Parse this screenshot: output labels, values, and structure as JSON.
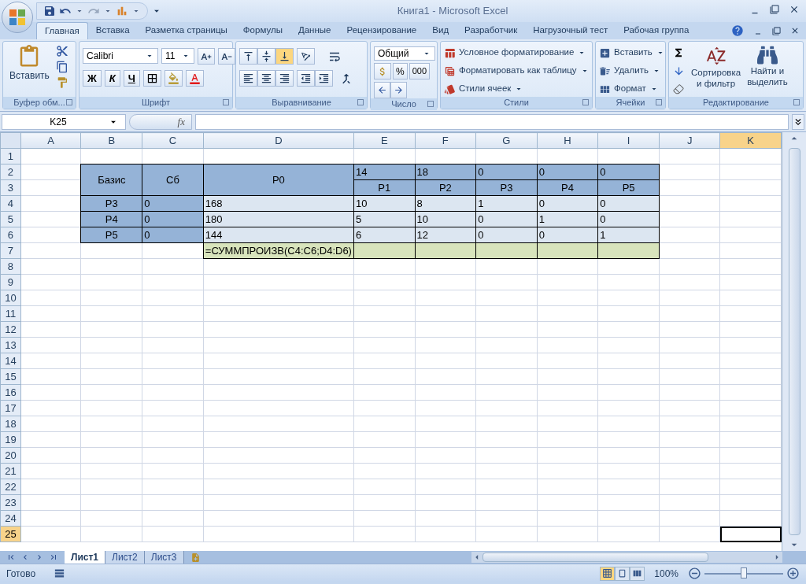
{
  "title_bar": {
    "title": "Книга1 - Microsoft Excel"
  },
  "ribbon_tabs": [
    {
      "label": "Главная",
      "selected": true
    },
    {
      "label": "Вставка",
      "selected": false
    },
    {
      "label": "Разметка страницы",
      "selected": false
    },
    {
      "label": "Формулы",
      "selected": false
    },
    {
      "label": "Данные",
      "selected": false
    },
    {
      "label": "Рецензирование",
      "selected": false
    },
    {
      "label": "Вид",
      "selected": false
    },
    {
      "label": "Разработчик",
      "selected": false
    },
    {
      "label": "Нагрузочный тест",
      "selected": false
    },
    {
      "label": "Рабочая группа",
      "selected": false
    }
  ],
  "ribbon": {
    "clipboard": {
      "paste": "Вставить",
      "label": "Буфер обм..."
    },
    "font": {
      "name": "Calibri",
      "size": "11",
      "bold": "Ж",
      "italic": "К",
      "underline": "Ч",
      "label": "Шрифт"
    },
    "alignment": {
      "vertical": [
        {
          "kind": "top",
          "selected": false
        },
        {
          "kind": "middle",
          "selected": false
        },
        {
          "kind": "bottom",
          "selected": true
        }
      ],
      "label": "Выравнивание"
    },
    "number": {
      "format": "Общий",
      "percent": "%",
      "thousands": "000",
      "label": "Число"
    },
    "styles": {
      "buttons": [
        "Условное форматирование",
        "Форматировать как таблицу",
        "Стили ячеек"
      ],
      "label": "Стили"
    },
    "cells": {
      "buttons": [
        "Вставить",
        "Удалить",
        "Формат"
      ],
      "label": "Ячейки"
    },
    "editing": {
      "sort": [
        "Сортировка",
        "и фильтр"
      ],
      "find": [
        "Найти и",
        "выделить"
      ],
      "label": "Редактирование"
    }
  },
  "formula_bar": {
    "name_box": "K25",
    "fx": "fx"
  },
  "sheet": {
    "columns": [
      {
        "label": "A",
        "selected": false
      },
      {
        "label": "B",
        "selected": false
      },
      {
        "label": "C",
        "selected": false
      },
      {
        "label": "D",
        "selected": false
      },
      {
        "label": "E",
        "selected": false
      },
      {
        "label": "F",
        "selected": false
      },
      {
        "label": "G",
        "selected": false
      },
      {
        "label": "H",
        "selected": false
      },
      {
        "label": "I",
        "selected": false
      },
      {
        "label": "J",
        "selected": false
      },
      {
        "label": "K",
        "selected": true
      }
    ],
    "rows": [
      {
        "number": "1",
        "selected": false
      },
      {
        "number": "2",
        "selected": false,
        "cells": [
          {
            "kind": "empty"
          },
          {
            "kind": "tall",
            "text": "Базис"
          },
          {
            "kind": "tall",
            "text": "Сб"
          },
          {
            "kind": "tall",
            "text": "P0"
          },
          {
            "kind": "head_left",
            "text": "14"
          },
          {
            "kind": "head_left",
            "text": "18"
          },
          {
            "kind": "head_left",
            "text": "0"
          },
          {
            "kind": "head_left",
            "text": "0"
          },
          {
            "kind": "head_left",
            "text": "0"
          },
          {
            "kind": "empty"
          },
          {
            "kind": "empty"
          }
        ]
      },
      {
        "number": "3",
        "selected": false,
        "cells": [
          {
            "kind": "empty"
          },
          {
            "kind": "head",
            "text": "P1"
          },
          {
            "kind": "head",
            "text": "P2"
          },
          {
            "kind": "head",
            "text": "P3"
          },
          {
            "kind": "head",
            "text": "P4"
          },
          {
            "kind": "head",
            "text": "P5"
          },
          {
            "kind": "empty"
          },
          {
            "kind": "empty"
          }
        ]
      },
      {
        "number": "4",
        "selected": false,
        "cells": [
          {
            "kind": "empty"
          },
          {
            "kind": "head",
            "text": "P3"
          },
          {
            "kind": "head_left",
            "text": "0"
          },
          {
            "kind": "value",
            "text": "168"
          },
          {
            "kind": "value",
            "text": "10"
          },
          {
            "kind": "value",
            "text": "8"
          },
          {
            "kind": "value",
            "text": "1"
          },
          {
            "kind": "value",
            "text": "0"
          },
          {
            "kind": "value",
            "text": "0"
          },
          {
            "kind": "empty"
          },
          {
            "kind": "empty"
          }
        ]
      },
      {
        "number": "5",
        "selected": false,
        "cells": [
          {
            "kind": "empty"
          },
          {
            "kind": "head",
            "text": "P4"
          },
          {
            "kind": "head_left",
            "text": "0"
          },
          {
            "kind": "value",
            "text": "180"
          },
          {
            "kind": "value",
            "text": "5"
          },
          {
            "kind": "value",
            "text": "10"
          },
          {
            "kind": "value",
            "text": "0"
          },
          {
            "kind": "value",
            "text": "1"
          },
          {
            "kind": "value",
            "text": "0"
          },
          {
            "kind": "empty"
          },
          {
            "kind": "empty"
          }
        ]
      },
      {
        "number": "6",
        "selected": false,
        "cells": [
          {
            "kind": "empty"
          },
          {
            "kind": "head",
            "text": "P5"
          },
          {
            "kind": "head_left",
            "text": "0"
          },
          {
            "kind": "value",
            "text": "144"
          },
          {
            "kind": "value",
            "text": "6"
          },
          {
            "kind": "value",
            "text": "12"
          },
          {
            "kind": "value",
            "text": "0"
          },
          {
            "kind": "value",
            "text": "0"
          },
          {
            "kind": "value",
            "text": "1"
          },
          {
            "kind": "empty"
          },
          {
            "kind": "empty"
          }
        ]
      },
      {
        "number": "7",
        "selected": false,
        "cells": [
          {
            "kind": "empty"
          },
          {
            "kind": "empty"
          },
          {
            "kind": "empty"
          },
          {
            "kind": "total",
            "text": "=СУММПРОИЗВ(C4:C6;D4:D6)"
          },
          {
            "kind": "total"
          },
          {
            "kind": "total"
          },
          {
            "kind": "total"
          },
          {
            "kind": "total"
          },
          {
            "kind": "total"
          },
          {
            "kind": "empty"
          },
          {
            "kind": "empty"
          }
        ]
      },
      {
        "number": "8",
        "selected": false
      },
      {
        "number": "9",
        "selected": false
      },
      {
        "number": "10",
        "selected": false
      },
      {
        "number": "11",
        "selected": false
      },
      {
        "number": "12",
        "selected": false
      },
      {
        "number": "13",
        "selected": false
      },
      {
        "number": "14",
        "selected": false
      },
      {
        "number": "15",
        "selected": false
      },
      {
        "number": "16",
        "selected": false
      },
      {
        "number": "17",
        "selected": false
      },
      {
        "number": "18",
        "selected": false
      },
      {
        "number": "19",
        "selected": false
      },
      {
        "number": "20",
        "selected": false
      },
      {
        "number": "21",
        "selected": false
      },
      {
        "number": "22",
        "selected": false
      },
      {
        "number": "23",
        "selected": false
      },
      {
        "number": "24",
        "selected": false
      },
      {
        "number": "25",
        "selected": true
      }
    ]
  },
  "sheet_tabs": [
    {
      "label": "Лист1",
      "selected": true
    },
    {
      "label": "Лист2",
      "selected": false
    },
    {
      "label": "Лист3",
      "selected": false
    }
  ],
  "status_bar": {
    "status": "Готово",
    "views": [
      {
        "kind": "normal",
        "selected": true
      },
      {
        "kind": "page_layout",
        "selected": false
      },
      {
        "kind": "page_break",
        "selected": false
      }
    ],
    "zoom": "100%",
    "zoom_slider": {
      "level": 0.5
    }
  }
}
